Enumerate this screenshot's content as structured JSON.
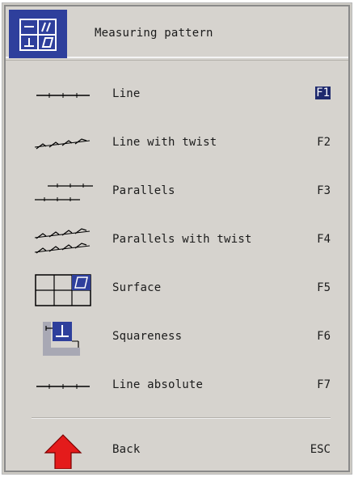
{
  "header": {
    "title": "Measuring pattern"
  },
  "menu": {
    "items": [
      {
        "label": "Line",
        "key": "F1",
        "icon": "line-icon",
        "selected": true
      },
      {
        "label": "Line with twist",
        "key": "F2",
        "icon": "line-twist-icon"
      },
      {
        "label": "Parallels",
        "key": "F3",
        "icon": "parallels-icon"
      },
      {
        "label": "Parallels with twist",
        "key": "F4",
        "icon": "parallels-twist-icon"
      },
      {
        "label": "Surface",
        "key": "F5",
        "icon": "surface-icon"
      },
      {
        "label": "Squareness",
        "key": "F6",
        "icon": "squareness-icon"
      },
      {
        "label": "Line absolute",
        "key": "F7",
        "icon": "line-absolute-icon"
      }
    ],
    "back": {
      "label": "Back",
      "key": "ESC",
      "icon": "up-arrow-icon"
    }
  },
  "colors": {
    "header_icon_bg": "#2e3f9c",
    "selected_key_bg": "#1f2a6e",
    "back_arrow": "#e41b1b",
    "panel_bg": "#d6d3ce"
  }
}
